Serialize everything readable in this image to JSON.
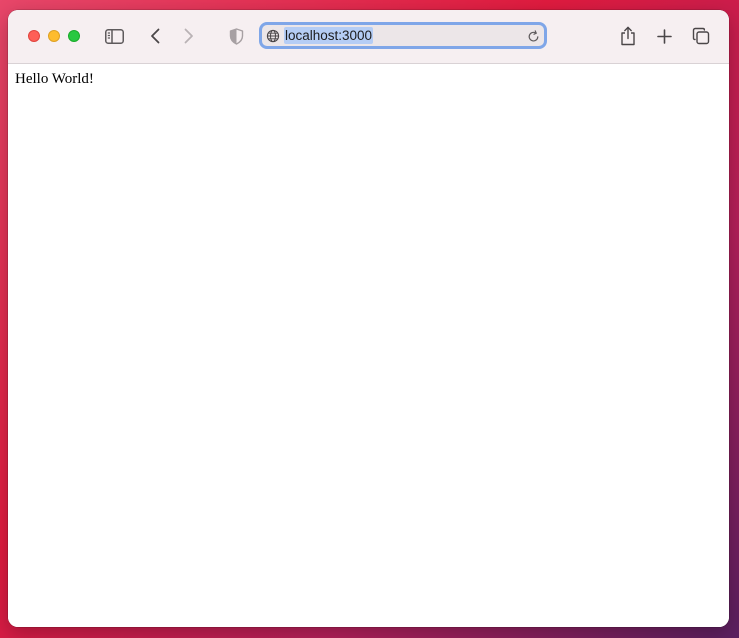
{
  "toolbar": {
    "address": {
      "url": "localhost:3000"
    },
    "icons": {
      "sidebar": "sidebar-icon",
      "back": "chevron-left-icon",
      "forward": "chevron-right-icon",
      "privacy": "shield-icon",
      "globe": "globe-icon",
      "reload": "reload-icon",
      "share": "share-icon",
      "new_tab": "plus-icon",
      "tabs": "tabs-overview-icon"
    }
  },
  "page": {
    "body_text": "Hello World!"
  },
  "colors": {
    "close": "#fe5f57",
    "minimize": "#febc2e",
    "maximize": "#28c840",
    "address_focus_ring": "#7fa6e8",
    "url_selection": "#b5cdf5"
  }
}
